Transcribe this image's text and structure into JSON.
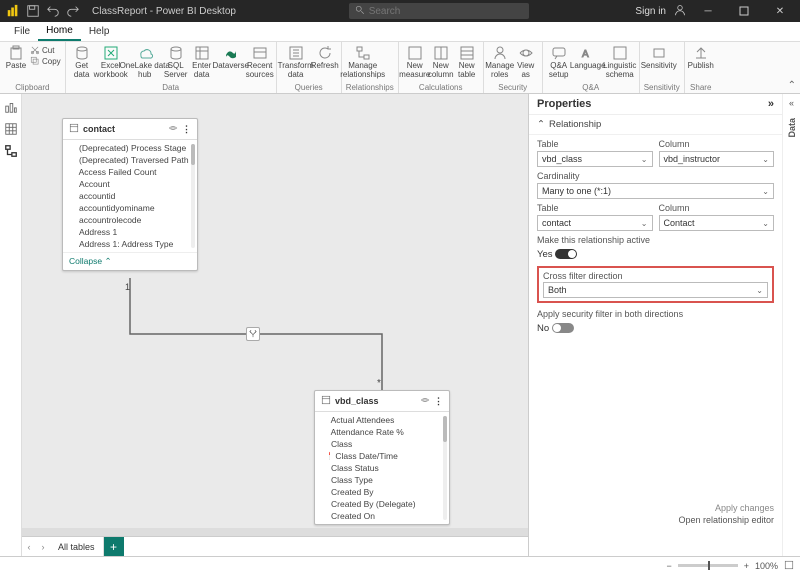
{
  "title": "ClassReport - Power BI Desktop",
  "titlebar": {
    "signin": "Sign in"
  },
  "search": {
    "placeholder": "Search"
  },
  "menu": {
    "file": "File",
    "home": "Home",
    "help": "Help"
  },
  "ribbon": {
    "clipboard": {
      "label": "Clipboard",
      "paste": "Paste",
      "cut": "Cut",
      "copy": "Copy"
    },
    "data": {
      "label": "Data",
      "get": "Get\ndata",
      "excel": "Excel\nworkbook",
      "onelake": "OneLake data\nhub",
      "sql": "SQL\nServer",
      "enter": "Enter\ndata",
      "dataverse": "Dataverse",
      "recent": "Recent\nsources"
    },
    "queries": {
      "label": "Queries",
      "transform": "Transform\ndata",
      "refresh": "Refresh"
    },
    "relationships": {
      "label": "Relationships",
      "manage": "Manage\nrelationships"
    },
    "calculations": {
      "label": "Calculations",
      "measure": "New\nmeasure",
      "column": "New\ncolumn",
      "table": "New\ntable"
    },
    "security": {
      "label": "Security",
      "roles": "Manage\nroles",
      "viewas": "View\nas"
    },
    "qa": {
      "label": "Q&A",
      "setup": "Q&A\nsetup",
      "lang": "Language",
      "ling": "Linguistic\nschema"
    },
    "sens": {
      "label": "Sensitivity",
      "btn": "Sensitivity"
    },
    "share": {
      "label": "Share",
      "publish": "Publish"
    }
  },
  "tables": {
    "contact": {
      "name": "contact",
      "fields": [
        "(Deprecated) Process Stage",
        "(Deprecated) Traversed Path",
        "Access Failed Count",
        "Account",
        "accountid",
        "accountidyominame",
        "accountrolecode",
        "Address 1",
        "Address 1: Address Type"
      ],
      "sigmaIdx": [
        2
      ],
      "collapse": "Collapse"
    },
    "vbd_class": {
      "name": "vbd_class",
      "fields": [
        "Actual Attendees",
        "Attendance Rate %",
        "Class",
        "Class Date/Time",
        "Class Status",
        "Class Type",
        "Created By",
        "Created By (Delegate)",
        "Created On"
      ],
      "sigmaIdx": [
        0,
        1
      ],
      "dateIdx": [
        3
      ]
    }
  },
  "properties": {
    "title": "Properties",
    "section": "Relationship",
    "table1_lbl": "Table",
    "col1_lbl": "Column",
    "table1": "vbd_class",
    "col1": "vbd_instructor",
    "cardinality_lbl": "Cardinality",
    "cardinality": "Many to one (*:1)",
    "table2_lbl": "Table",
    "col2_lbl": "Column",
    "table2": "contact",
    "col2": "Contact",
    "active_lbl": "Make this relationship active",
    "active_val": "Yes",
    "crossfilter_lbl": "Cross filter direction",
    "crossfilter": "Both",
    "secfilter_lbl": "Apply security filter in both directions",
    "secfilter_val": "No",
    "apply": "Apply changes",
    "open_editor": "Open relationship editor"
  },
  "right_rail": {
    "data": "Data"
  },
  "tabs": {
    "all": "All tables"
  },
  "status": {
    "zoom": "100%"
  }
}
